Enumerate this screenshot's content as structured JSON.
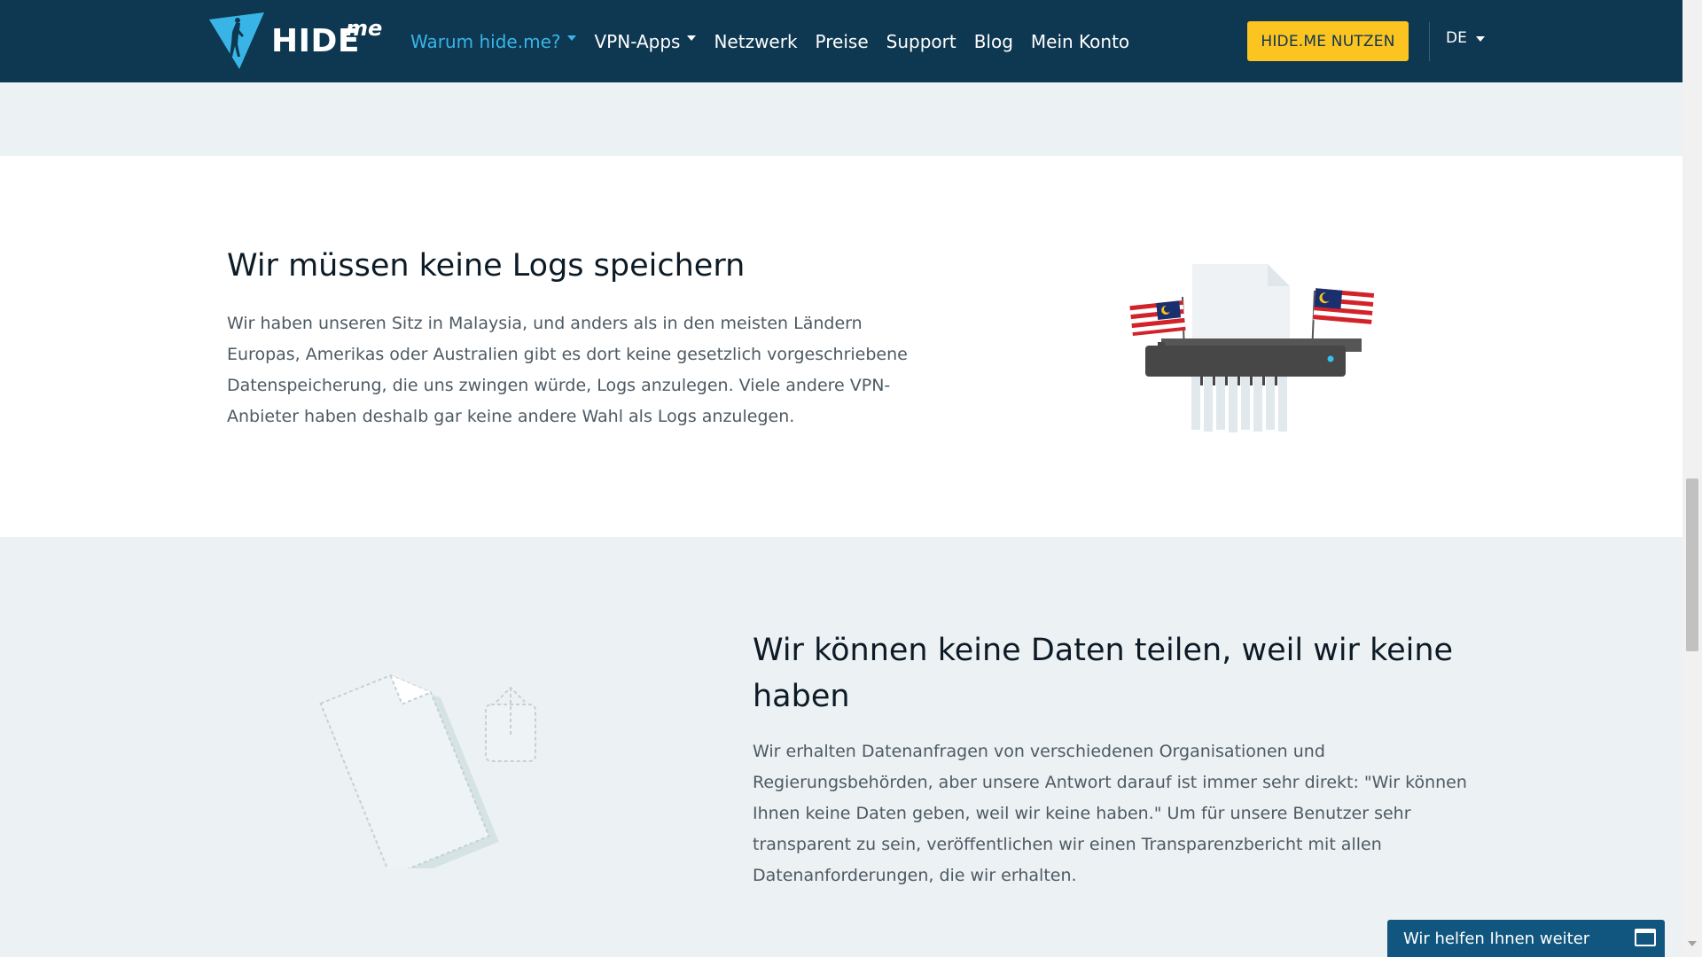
{
  "nav": {
    "logo_text": "HIDE",
    "logo_suffix": "me",
    "links": [
      {
        "label": "Warum hide.me?",
        "has_dropdown": true,
        "active": true
      },
      {
        "label": "VPN-Apps",
        "has_dropdown": true,
        "active": false
      },
      {
        "label": "Netzwerk",
        "has_dropdown": false,
        "active": false
      },
      {
        "label": "Preise",
        "has_dropdown": false,
        "active": false
      },
      {
        "label": "Support",
        "has_dropdown": false,
        "active": false
      },
      {
        "label": "Blog",
        "has_dropdown": false,
        "active": false
      },
      {
        "label": "Mein Konto",
        "has_dropdown": false,
        "active": false
      }
    ],
    "cta_label": "HIDE.ME NUTZEN",
    "language": "DE"
  },
  "section_logs": {
    "title": "Wir müssen keine Logs speichern",
    "text": "Wir haben unseren Sitz in Malaysia, und anders als in den meisten Ländern Europas, Amerikas oder Australien gibt es dort keine gesetzlich vorgeschriebene Datenspeicherung, die uns zwingen würde, Logs anzulegen. Viele andere VPN-Anbieter haben deshalb gar keine andere Wahl als Logs anzulegen."
  },
  "section_data": {
    "title": "Wir können keine Daten teilen, weil wir keine haben",
    "text": "Wir erhalten Datenanfragen von verschiedenen Organisationen und Regierungsbehörden, aber unsere Antwort darauf ist immer sehr direkt: \"Wir können Ihnen keine Daten geben, weil wir keine haben.\" Um für unsere Benutzer sehr transparent zu sein, veröffentlichen wir einen Transparenzbericht mit allen Datenanforderungen, die wir erhalten."
  },
  "chat": {
    "label": "Wir helfen Ihnen weiter"
  },
  "colors": {
    "nav_bg": "#0e3751",
    "accent": "#38b5e6",
    "cta_bg": "#fcc420",
    "page_bg": "#ecf1f3",
    "chat_bg": "#11567f"
  }
}
